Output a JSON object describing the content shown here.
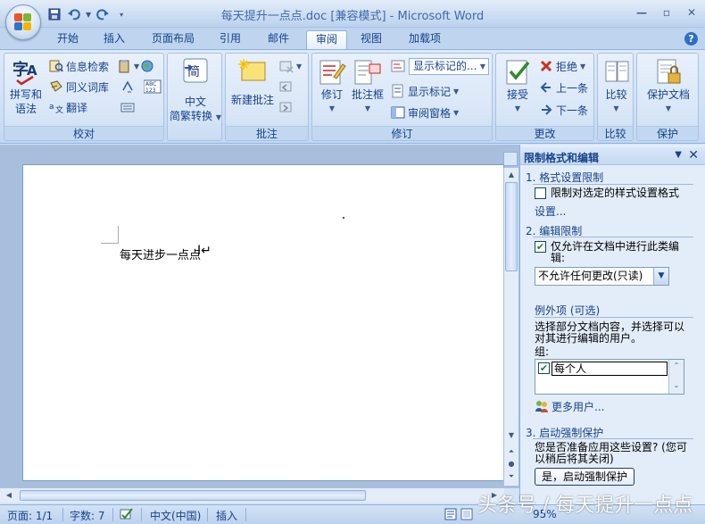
{
  "titlebar": {
    "title": "每天提升一点点.doc [兼容模式] - Microsoft Word",
    "qat_icons": [
      "save-icon",
      "undo-icon",
      "redo-icon",
      "customize-icon"
    ]
  },
  "tabs": [
    {
      "label": "开始",
      "active": false
    },
    {
      "label": "插入",
      "active": false
    },
    {
      "label": "页面布局",
      "active": false
    },
    {
      "label": "引用",
      "active": false
    },
    {
      "label": "邮件",
      "active": false
    },
    {
      "label": "审阅",
      "active": true
    },
    {
      "label": "视图",
      "active": false
    },
    {
      "label": "加载项",
      "active": false
    }
  ],
  "ribbon": {
    "proofing": {
      "label": "校对",
      "spelling_line1": "拼写和",
      "spelling_line2": "语法",
      "research": "信息检索",
      "thesaurus": "同义词库",
      "translate": "翻译",
      "abc_icon": "ABC\n123"
    },
    "chinese": {
      "label_line1": "中文",
      "label_line2": "简繁转换",
      "big_icon_text": "简"
    },
    "comments": {
      "label": "批注",
      "new_comment": "新建批注"
    },
    "tracking": {
      "label": "修订",
      "track_changes": "修订",
      "balloons": "批注框",
      "display_combo": "显示标记的...",
      "show_markup": "显示标记",
      "reviewing_pane": "审阅窗格"
    },
    "changes": {
      "label": "更改",
      "accept": "接受",
      "reject": "拒绝",
      "previous": "上一条",
      "next": "下一条"
    },
    "compare": {
      "label": "比较"
    },
    "protect": {
      "label": "保护",
      "protect_document": "保护文档"
    }
  },
  "document": {
    "text": "每天进步一点点"
  },
  "pane": {
    "title": "限制格式和编辑",
    "section1": {
      "title": "1.  格式设置限制",
      "checkbox_label": "限制对选定的样式设置格式",
      "checked": false,
      "link": "设置..."
    },
    "section2": {
      "title": "2.  编辑限制",
      "checkbox_line1": "仅允许在文档中进行此类编",
      "checkbox_line2": "辑:",
      "checked": true,
      "select_value": "不允许任何更改(只读)",
      "exceptions_title": "例外项 (可选)",
      "exceptions_desc_line1": "选择部分文档内容，并选择可以",
      "exceptions_desc_line2": "对其进行编辑的用户。",
      "groups_label": "组:",
      "group_item": "每个人",
      "group_checked": true,
      "more_users": "更多用户..."
    },
    "section3": {
      "title": "3.  启动强制保护",
      "desc_line1": "您是否准备应用这些设置?  (您可",
      "desc_line2": "以稍后将其关闭)",
      "button": "是，启动强制保护"
    }
  },
  "statusbar": {
    "page": "页面: 1/1",
    "words": "字数: 7",
    "language": "中文(中国)",
    "mode": "插入",
    "zoom": "95%"
  },
  "watermark": "头条号 / 每天提升一点点"
}
